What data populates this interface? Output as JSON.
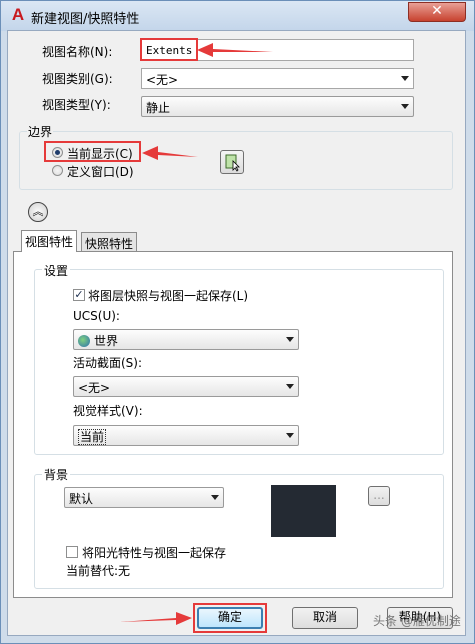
{
  "window": {
    "title": "新建视图/快照特性",
    "close_glyph": "✕",
    "app_icon_glyph": "A"
  },
  "form": {
    "view_name": {
      "label": "视图名称(N):",
      "value": "Extents"
    },
    "view_category": {
      "label": "视图类别(G):",
      "value": "<无>"
    },
    "view_type": {
      "label": "视图类型(Y):",
      "value": "静止"
    }
  },
  "boundary": {
    "title": "边界",
    "current_display": "当前显示(C)",
    "define_window": "定义窗口(D)",
    "selected": "current_display"
  },
  "tabs": [
    {
      "label": "视图特性",
      "active": true
    },
    {
      "label": "快照特性",
      "active": false
    }
  ],
  "settings": {
    "title": "设置",
    "save_layer_snapshot": {
      "label": "将图层快照与视图一起保存(L)",
      "checked": true
    },
    "ucs": {
      "label": "UCS(U):",
      "value": "世界"
    },
    "live_section": {
      "label": "活动截面(S):",
      "value": "<无>"
    },
    "visual_style": {
      "label": "视觉样式(V):",
      "value": "当前"
    }
  },
  "background": {
    "title": "背景",
    "value": "默认",
    "browse_label": "...",
    "swatch_color": "#242a33",
    "save_sun": {
      "label": "将阳光特性与视图一起保存",
      "checked": false
    },
    "current_override": "当前替代:无"
  },
  "buttons": {
    "ok": "确定",
    "cancel": "取消",
    "help": "帮助(H)"
  },
  "annotation_color": "#e53a3a",
  "watermark": "头条 @雁优制途"
}
